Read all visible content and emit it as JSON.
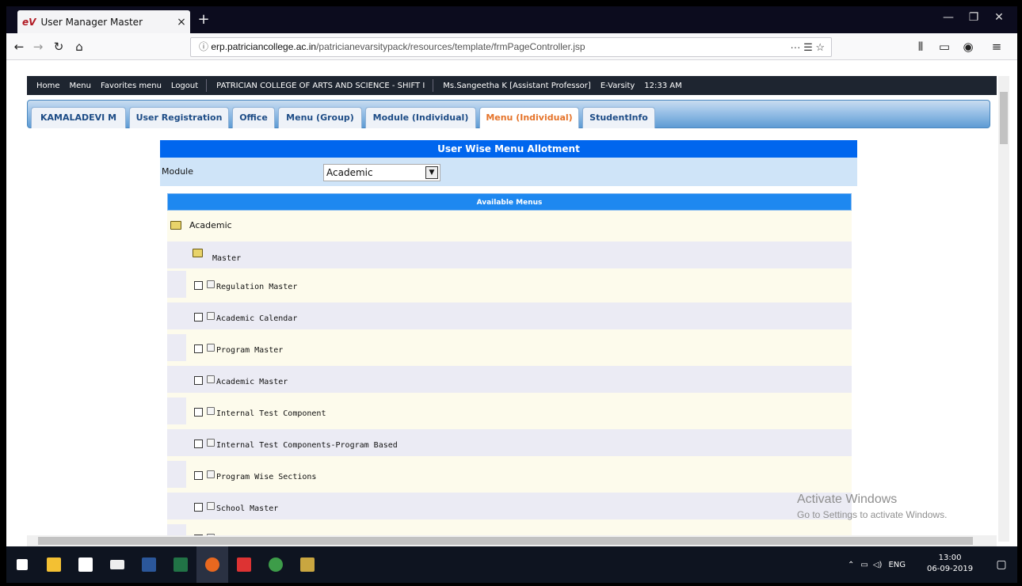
{
  "browser": {
    "tab_title": "User Manager Master",
    "tab_favicon": "eV",
    "new_tab": "+",
    "close_tab": "×",
    "url_host": "erp.patriciancollege.ac.in",
    "url_path": "/patricianevarsitypack/resources/template/frmPageController.jsp",
    "url_actions": "··· ☰ ☆"
  },
  "site_menu": {
    "home": "Home",
    "menu": "Menu",
    "favorites": "Favorites menu",
    "logout": "Logout",
    "college": "PATRICIAN COLLEGE OF ARTS AND SCIENCE - SHIFT I",
    "user": "Ms.Sangeetha K [Assistant Professor]",
    "app": "E-Varsity",
    "time": "12:33 AM"
  },
  "tabs": [
    {
      "label": "KAMALADEVI M"
    },
    {
      "label": "User Registration"
    },
    {
      "label": "Office"
    },
    {
      "label": "Menu (Group)"
    },
    {
      "label": "Module (Individual)"
    },
    {
      "label": "Menu (Individual)",
      "active": true
    },
    {
      "label": "StudentInfo"
    }
  ],
  "form": {
    "title": "User Wise Menu Allotment",
    "module_label": "Module",
    "module_value": "Academic",
    "available_header": "Available Menus"
  },
  "tree": {
    "root": "Academic",
    "group": "Master",
    "items": [
      "Regulation Master",
      "Academic Calendar",
      "Program Master",
      "Academic Master",
      "Internal Test Component",
      "Internal Test Components-Program Based",
      "Program Wise Sections",
      "School Master"
    ]
  },
  "watermark": {
    "title": "Activate Windows",
    "subtitle": "Go to Settings to activate Windows."
  },
  "taskbar": {
    "lang": "ENG",
    "time": "13:00",
    "date": "06-09-2019"
  }
}
